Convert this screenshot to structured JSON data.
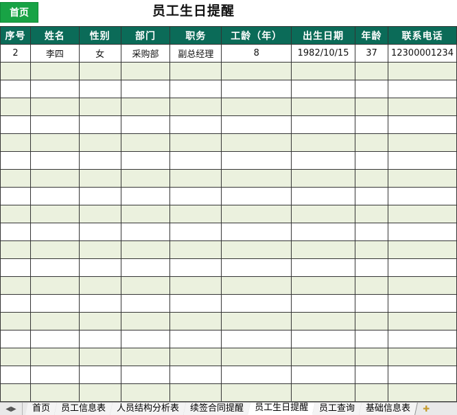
{
  "home_button": {
    "label": "首页"
  },
  "title": "员工生日提醒",
  "table": {
    "headers": [
      "序号",
      "姓名",
      "性别",
      "部门",
      "职务",
      "工龄（年）",
      "出生日期",
      "年龄",
      "联系电话"
    ],
    "rows": [
      [
        "2",
        "李四",
        "女",
        "采购部",
        "副总经理",
        "8",
        "1982/10/15",
        "37",
        "12300001234"
      ]
    ],
    "blank_row_count": 19
  },
  "tabbar": {
    "nav_icon": "sheet-nav-arrows-icon",
    "tabs": [
      {
        "label": "首页",
        "active": false
      },
      {
        "label": "员工信息表",
        "active": false
      },
      {
        "label": "人员结构分析表",
        "active": false
      },
      {
        "label": "续签合同提醒",
        "active": false
      },
      {
        "label": "员工生日提醒",
        "active": true
      },
      {
        "label": "员工查询",
        "active": false
      },
      {
        "label": "基础信息表",
        "active": false
      }
    ],
    "add_icon": "new-sheet-icon"
  },
  "colors": {
    "header_bg": "#0b6b58",
    "home_button_bg": "#18a345",
    "alt_row_bg": "#ebf1de"
  }
}
